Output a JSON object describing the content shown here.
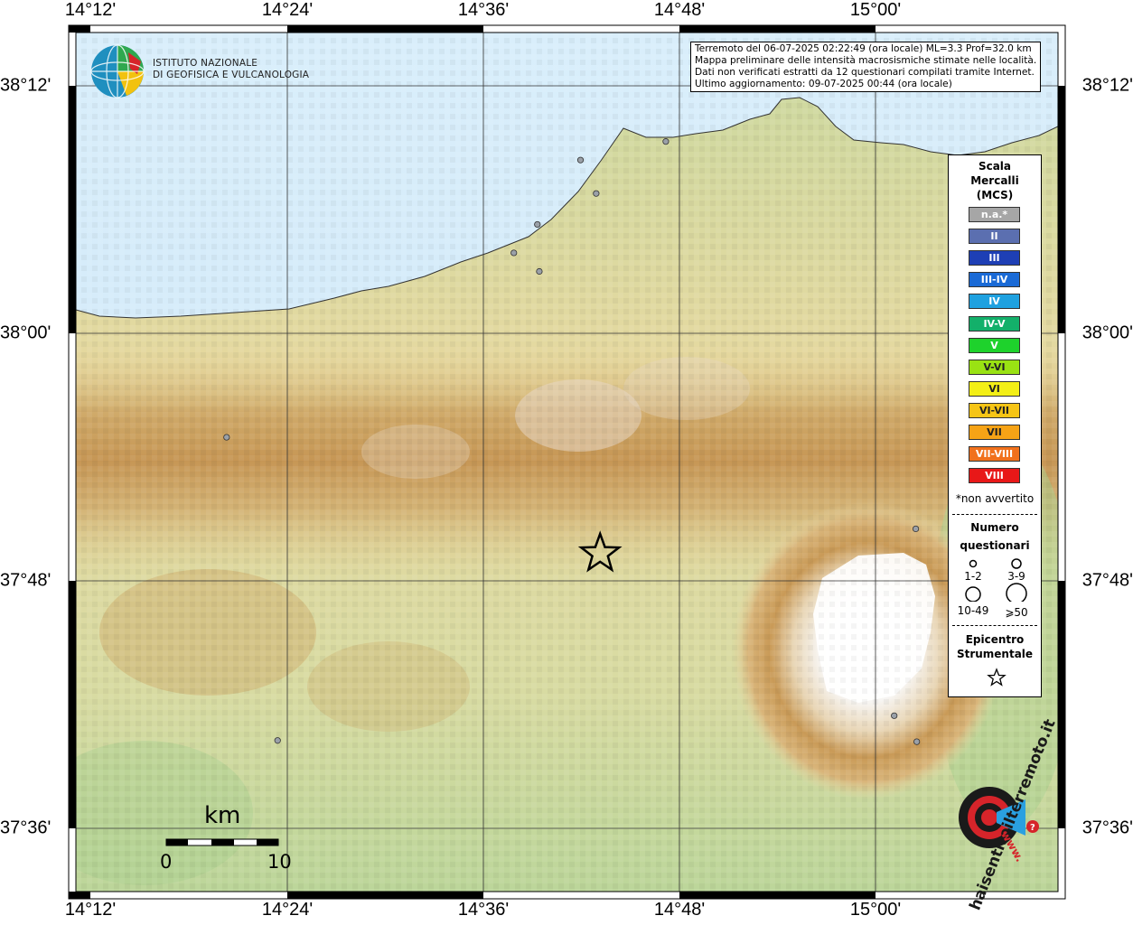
{
  "axes": {
    "lon_labels": [
      "14°12'",
      "14°24'",
      "14°36'",
      "14°48'",
      "15°00'"
    ],
    "lat_labels": [
      "38°12'",
      "38°00'",
      "37°48'",
      "37°36'"
    ]
  },
  "institute": {
    "name_line1": "ISTITUTO NAZIONALE",
    "name_line2": "DI GEOFISICA E VULCANOLOGIA"
  },
  "info": {
    "line1": "Terremoto del 06-07-2025 02:22:49 (ora locale) ML=3.3 Prof=32.0 km",
    "line2": "Mappa preliminare delle intensità macrosismiche stimate nelle località.",
    "line3": "Dati non verificati estratti da 12 questionari compilati tramite Internet.",
    "line4": "Ultimo aggiornamento: 09-07-2025 00:44 (ora locale)"
  },
  "legend": {
    "title_line1": "Scala",
    "title_line2": "Mercalli",
    "title_line3": "(MCS)",
    "classes": [
      {
        "label": "n.a.*",
        "color": "#a6a6a6"
      },
      {
        "label": "II",
        "color": "#5b6fb0"
      },
      {
        "label": "III",
        "color": "#1e3fb5"
      },
      {
        "label": "III-IV",
        "color": "#1a6ad6"
      },
      {
        "label": "IV",
        "color": "#1fa1e0"
      },
      {
        "label": "IV-V",
        "color": "#13b06a"
      },
      {
        "label": "V",
        "color": "#1ed22c"
      },
      {
        "label": "V-VI",
        "color": "#9ae213"
      },
      {
        "label": "VI",
        "color": "#f3ef16"
      },
      {
        "label": "VI-VII",
        "color": "#f6c516"
      },
      {
        "label": "VII",
        "color": "#f6a316"
      },
      {
        "label": "VII-VIII",
        "color": "#f1711c"
      },
      {
        "label": "VIII",
        "color": "#e81818"
      }
    ],
    "note": "*non avvertito",
    "count_title_line1": "Numero",
    "count_title_line2": "questionari",
    "count_labels": [
      "1-2",
      "3-9",
      "10-49",
      "⩾50"
    ],
    "epicenter_title_line1": "Epicentro",
    "epicenter_title_line2": "Strumentale"
  },
  "scalebar": {
    "unit": "km",
    "start": "0",
    "end": "10"
  },
  "localities": [
    {
      "lon": 14.787,
      "lat": 38.155
    },
    {
      "lon": 14.7,
      "lat": 38.14
    },
    {
      "lon": 14.716,
      "lat": 38.113
    },
    {
      "lon": 14.656,
      "lat": 38.088
    },
    {
      "lon": 14.632,
      "lat": 38.065
    },
    {
      "lon": 14.658,
      "lat": 38.05
    },
    {
      "lon": 14.339,
      "lat": 37.916
    },
    {
      "lon": 15.042,
      "lat": 37.842
    },
    {
      "lon": 14.391,
      "lat": 37.671
    },
    {
      "lon": 15.02,
      "lat": 37.691
    },
    {
      "lon": 15.043,
      "lat": 37.67
    }
  ],
  "epicenter": {
    "lon": 14.72,
    "lat": 37.822
  },
  "watermark": {
    "site_text": "haisentitoilterremoto.it",
    "url_text": "www.",
    "colors": {
      "black": "#1a1a1a",
      "red": "#d6242a",
      "blue": "#2aa0e0"
    }
  }
}
